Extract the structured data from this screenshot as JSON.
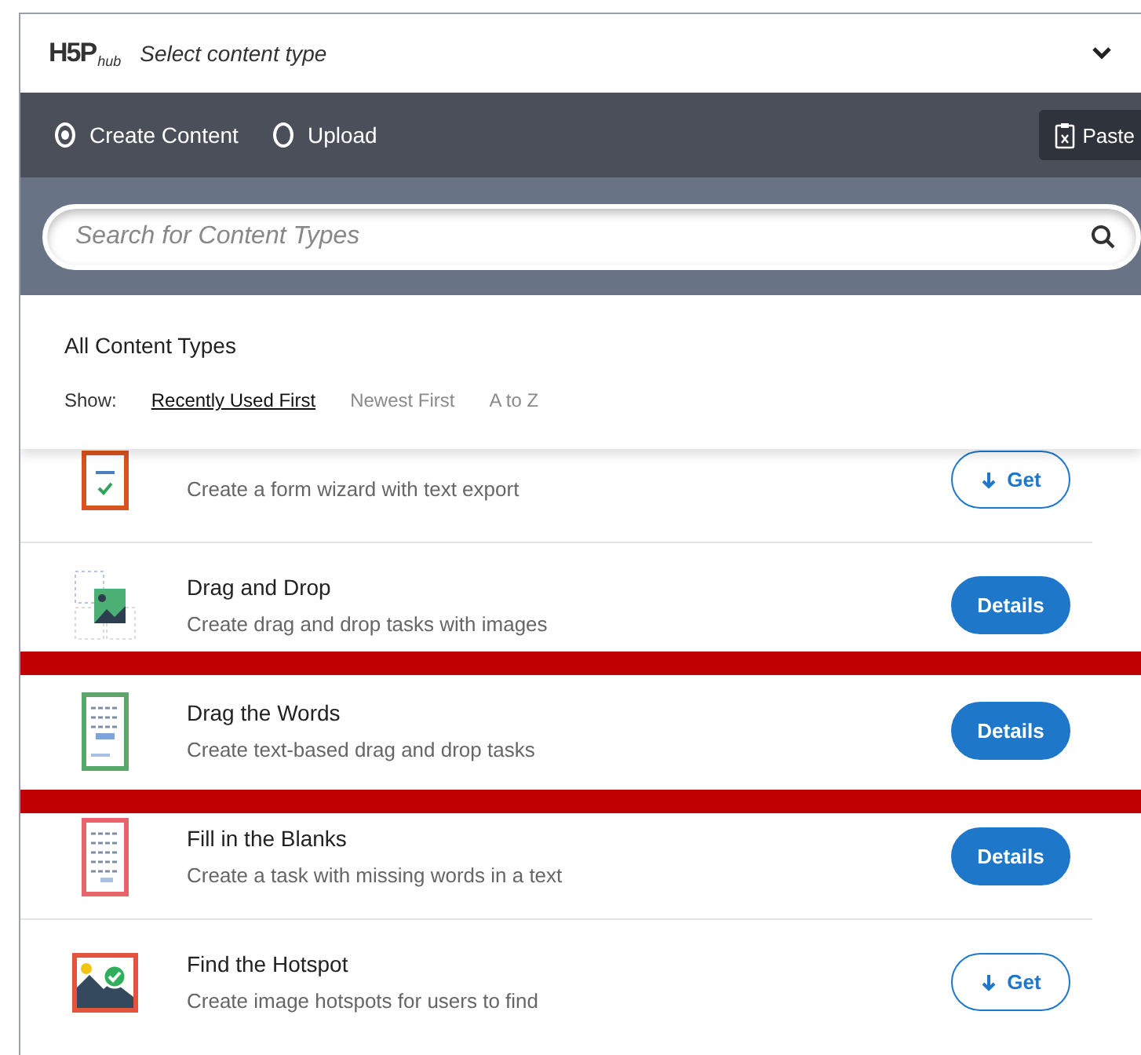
{
  "header": {
    "logo_main": "H5P",
    "logo_sub": "hub",
    "title": "Select content type"
  },
  "modes": [
    {
      "label": "Create Content",
      "selected": true
    },
    {
      "label": "Upload",
      "selected": false
    }
  ],
  "paste_button": {
    "label": "Paste"
  },
  "search": {
    "placeholder": "Search for Content Types"
  },
  "section_title": "All Content Types",
  "sort": {
    "label": "Show:",
    "options": [
      {
        "label": "Recently Used First",
        "selected": true
      },
      {
        "label": "Newest First",
        "selected": false
      },
      {
        "label": "A to Z",
        "selected": false
      }
    ]
  },
  "content_types": [
    {
      "kind": "form",
      "description": "Create a form wizard with text export",
      "action": {
        "kind": "get",
        "label": "Get"
      },
      "highlighted": false
    },
    {
      "kind": "dragdrop",
      "title": "Drag and Drop",
      "description": "Create drag and drop tasks with images",
      "action": {
        "kind": "details",
        "label": "Details"
      },
      "highlighted": false
    },
    {
      "kind": "dragwords",
      "title": "Drag the Words",
      "description": "Create text-based drag and drop tasks",
      "action": {
        "kind": "details",
        "label": "Details"
      },
      "highlighted": true
    },
    {
      "kind": "blanks",
      "title": "Fill in the Blanks",
      "description": "Create a task with missing words in a text",
      "action": {
        "kind": "details",
        "label": "Details"
      },
      "highlighted": false
    },
    {
      "kind": "hotspot",
      "title": "Find the Hotspot",
      "description": "Create image hotspots for users to find",
      "action": {
        "kind": "get",
        "label": "Get"
      },
      "highlighted": false
    }
  ]
}
